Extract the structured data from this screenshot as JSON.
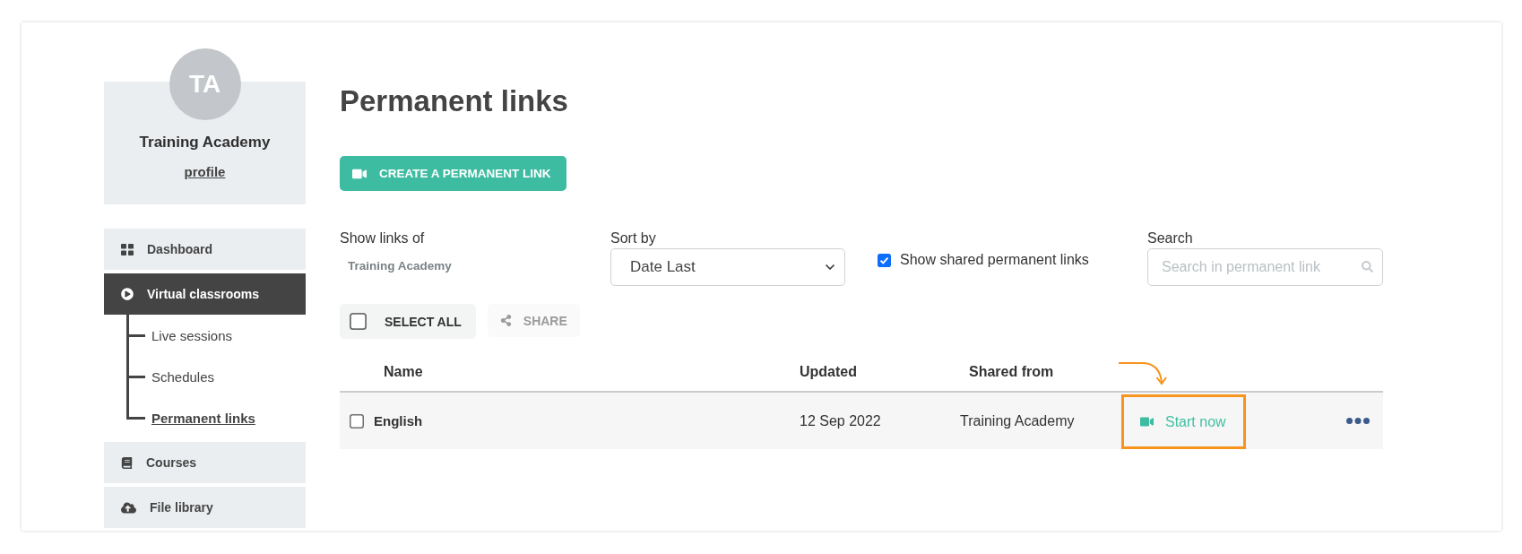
{
  "sidebar": {
    "avatar_initials": "TA",
    "name": "Training Academy",
    "profile_link": "profile",
    "nav": [
      {
        "label": "Dashboard",
        "selected": false
      },
      {
        "label": "Virtual classrooms",
        "selected": true,
        "children": [
          {
            "label": "Live sessions",
            "selected": false
          },
          {
            "label": "Schedules",
            "selected": false
          },
          {
            "label": "Permanent links",
            "selected": true
          }
        ]
      },
      {
        "label": "Courses",
        "selected": false
      },
      {
        "label": "File library",
        "selected": false
      }
    ]
  },
  "page": {
    "title": "Permanent links",
    "create_button": "CREATE A PERMANENT LINK"
  },
  "filters": {
    "owner": {
      "label": "Show links of",
      "value": "Training Academy"
    },
    "sort": {
      "label": "Sort by",
      "value": "Date Last"
    },
    "show_shared": {
      "label": "Show shared permanent links",
      "checked": true
    },
    "search": {
      "label": "Search",
      "placeholder": "Search in permanent link"
    }
  },
  "toolbar": {
    "select_all": {
      "label": "SELECT ALL",
      "checked": false
    },
    "share": {
      "label": "SHARE",
      "disabled": true
    }
  },
  "table": {
    "columns": [
      "Name",
      "Updated",
      "Shared from"
    ],
    "rows": [
      {
        "name": "English",
        "checked": false,
        "updated": "12 Sep 2022",
        "shared_from": "Training Academy",
        "action": "Start now",
        "highlighted": true
      }
    ]
  }
}
